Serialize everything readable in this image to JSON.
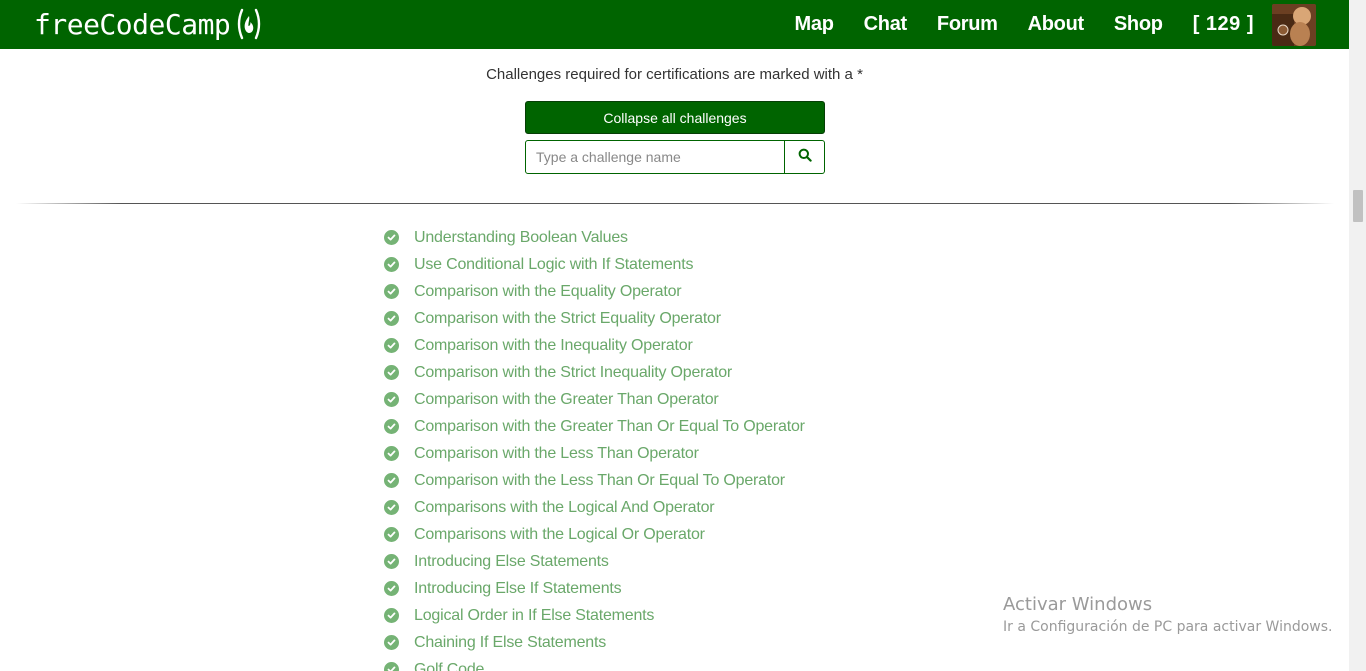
{
  "navbar": {
    "logo_text": "freeCodeCamp",
    "links": [
      {
        "label": "Map"
      },
      {
        "label": "Chat"
      },
      {
        "label": "Forum"
      },
      {
        "label": "About"
      },
      {
        "label": "Shop"
      }
    ],
    "points": "[ 129 ]"
  },
  "header": {
    "note": "Challenges required for certifications are marked with a *",
    "collapse_label": "Collapse all challenges",
    "search_placeholder": "Type a challenge name",
    "search_value": ""
  },
  "challenges": [
    {
      "label": "Understanding Boolean Values",
      "completed": true
    },
    {
      "label": "Use Conditional Logic with If Statements",
      "completed": true
    },
    {
      "label": "Comparison with the Equality Operator",
      "completed": true
    },
    {
      "label": "Comparison with the Strict Equality Operator",
      "completed": true
    },
    {
      "label": "Comparison with the Inequality Operator",
      "completed": true
    },
    {
      "label": "Comparison with the Strict Inequality Operator",
      "completed": true
    },
    {
      "label": "Comparison with the Greater Than Operator",
      "completed": true
    },
    {
      "label": "Comparison with the Greater Than Or Equal To Operator",
      "completed": true
    },
    {
      "label": "Comparison with the Less Than Operator",
      "completed": true
    },
    {
      "label": "Comparison with the Less Than Or Equal To Operator",
      "completed": true
    },
    {
      "label": "Comparisons with the Logical And Operator",
      "completed": true
    },
    {
      "label": "Comparisons with the Logical Or Operator",
      "completed": true
    },
    {
      "label": "Introducing Else Statements",
      "completed": true
    },
    {
      "label": "Introducing Else If Statements",
      "completed": true
    },
    {
      "label": "Logical Order in If Else Statements",
      "completed": true
    },
    {
      "label": "Chaining If Else Statements",
      "completed": true
    },
    {
      "label": "Golf Code",
      "completed": true
    }
  ],
  "watermark": {
    "title": "Activar Windows",
    "subtitle": "Ir a Configuración de PC para activar Windows."
  },
  "colors": {
    "brand_green": "#006400",
    "completed_green": "#6aa86a"
  }
}
